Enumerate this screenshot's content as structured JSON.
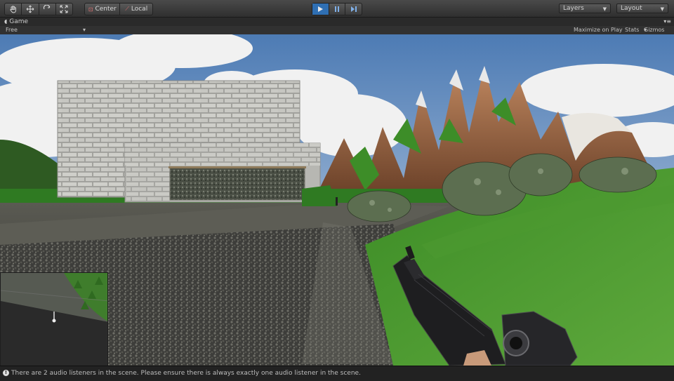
{
  "toolbar": {
    "pivot_label": "Center",
    "space_label": "Local",
    "layers_label": "Layers",
    "layout_label": "Layout"
  },
  "game_tab": {
    "title": "Game",
    "aspect_label": "Free Aspect",
    "maximize_label": "Maximize on Play",
    "stats_label": "Stats",
    "gizmos_label": "Gizmos"
  },
  "console": {
    "message": "There are 2 audio listeners in the scene. Please ensure there is always exactly one audio listener in the scene."
  },
  "colors": {
    "accent_play": "#2f6fb3",
    "sky": "#6f8fb5",
    "grass": "#3f8f2a"
  }
}
